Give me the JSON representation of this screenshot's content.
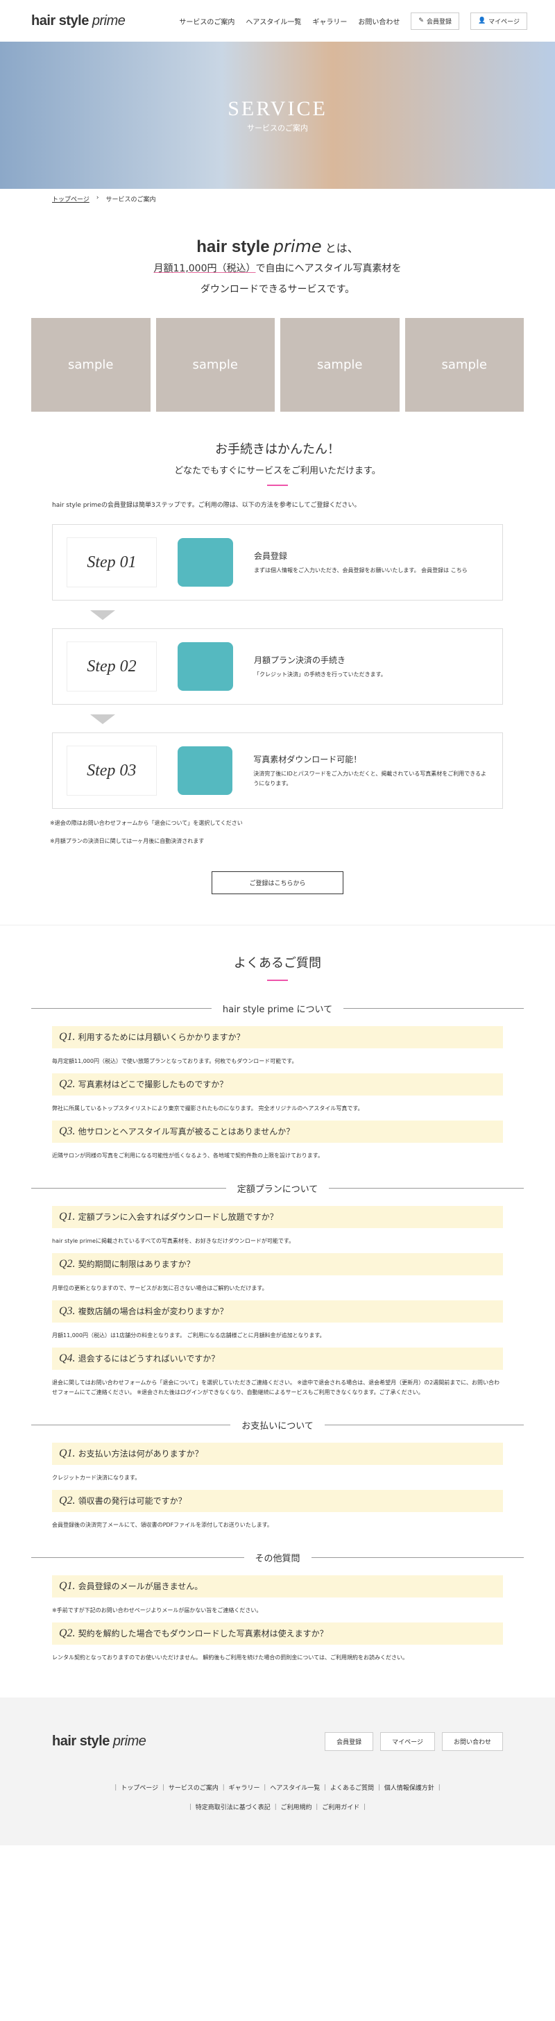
{
  "header": {
    "logo_bold": "hair style",
    "logo_italic": "prime",
    "nav": [
      "サービスのご案内",
      "ヘアスタイル一覧",
      "ギャラリー",
      "お問い合わせ"
    ],
    "member_btn": "会員登録",
    "mypage_btn": "マイページ"
  },
  "hero": {
    "title": "SERVICE",
    "subtitle": "サービスのご案内"
  },
  "breadcrumb": {
    "home": "トップページ",
    "current": "サービスのご案内"
  },
  "intro": {
    "logo_bold": "hair style",
    "logo_italic": "prime",
    "suffix": "とは、",
    "line1_price": "月額11,000円（税込）",
    "line1_rest": "で自由にヘアスタイル写真素材を",
    "line2": "ダウンロードできるサービスです。"
  },
  "gallery": [
    "sample",
    "sample",
    "sample",
    "sample"
  ],
  "steps_section": {
    "title": "お手続きはかんたん！",
    "subtitle": "どなたでもすぐにサービスをご利用いただけます。",
    "note": "hair style primeの会員登録は簡単3ステップです。ご利用の際は、以下の方法を参考にしてご登録ください。"
  },
  "steps": [
    {
      "label": "Step 01",
      "title": "会員登録",
      "text": "まずは個人情報をご入力いただき、会員登録をお願いいたします。 会員登録は こちら",
      "icon": "user-gear-icon"
    },
    {
      "label": "Step 02",
      "title": "月額プラン決済の手続き",
      "text": "「クレジット決済」の手続きを行っていただきます。",
      "icon": "laptop-icon"
    },
    {
      "label": "Step 03",
      "title": "写真素材ダウンロード可能！",
      "text": "決済完了後にIDとパスワードをご入力いただくと、掲載されている写真素材をご利用できるようになります。",
      "icon": "download-icon"
    }
  ],
  "step_notes": [
    "※退会の際はお問い合わせフォームから「退会について」を選択してください",
    "※月額プランの決済日に関しては一ヶ月後に自動決済されます"
  ],
  "register_btn": "ご登録はこちらから",
  "faq": {
    "title": "よくあるご質問",
    "categories": [
      {
        "name": "hair style prime について",
        "items": [
          {
            "num": "Q1.",
            "q": "利用するためには月額いくらかかりますか？",
            "a": "毎月定額11,000円（税込）で使い放題プランとなっております。何枚でもダウンロード可能です。"
          },
          {
            "num": "Q2.",
            "q": "写真素材はどこで撮影したものですか？",
            "a": "弊社に所属しているトップスタイリストにより東京で撮影されたものになります。 完全オリジナルのヘアスタイル写真です。"
          },
          {
            "num": "Q3.",
            "q": "他サロンとヘアスタイル写真が被ることはありませんか？",
            "a": "近隣サロンが同様の写真をご利用になる可能性が低くなるよう、各地域で契約件数の上限を設けております。"
          }
        ]
      },
      {
        "name": "定額プランについて",
        "items": [
          {
            "num": "Q1.",
            "q": "定額プランに入会すればダウンロードし放題ですか？",
            "a": "hair style primeに掲載されているすべての写真素材を、お好きなだけダウンロードが可能です。"
          },
          {
            "num": "Q2.",
            "q": "契約期間に制限はありますか？",
            "a": "月単位の更新となりますので、サービスがお気に召さない場合はご解約いただけます。"
          },
          {
            "num": "Q3.",
            "q": "複数店舗の場合は料金が変わりますか？",
            "a": "月額11,000円（税込）は1店舗分の料金となります。 ご利用になる店舗様ごとに月額料金が追加となります。"
          },
          {
            "num": "Q4.",
            "q": "退会するにはどうすればいいですか？",
            "a": "退会に関してはお問い合わせフォームから「退会について」を選択していただきご連絡ください。 ※途中で退会される場合は、退会希望月（更新月）の2週間前までに、お問い合わせフォームにてご連絡ください。 ※退会された後はログインができなくなり、自動継続によるサービスもご利用できなくなります。ご了承ください。"
          }
        ]
      },
      {
        "name": "お支払いについて",
        "items": [
          {
            "num": "Q1.",
            "q": "お支払い方法は何がありますか？",
            "a": "クレジットカード決済になります。"
          },
          {
            "num": "Q2.",
            "q": "領収書の発行は可能ですか？",
            "a": "会員登録後の決済完了メールにて、領収書のPDFファイルを添付してお送りいたします。"
          }
        ]
      },
      {
        "name": "その他質問",
        "items": [
          {
            "num": "Q1.",
            "q": "会員登録のメールが届きません。",
            "a": "※手前ですが下記のお問い合わせページよりメールが届かない旨をご連絡ください。"
          },
          {
            "num": "Q2.",
            "q": "契約を解約した場合でもダウンロードした写真素材は使えますか？",
            "a": "レンタル契約となっておりますのでお使いいただけません。 解約後もご利用を続けた場合の罰則金については、ご利用規約をお読みください。"
          }
        ]
      }
    ]
  },
  "footer": {
    "logo_bold": "hair style",
    "logo_italic": "prime",
    "member_btn": "会員登録",
    "mypage_btn": "マイページ",
    "contact_btn": "お問い合わせ",
    "links": "｜ トップページ ｜ サービスのご案内 ｜ ギャラリー ｜ ヘアスタイル一覧 ｜ よくあるご質問 ｜ 個人情報保護方針 ｜",
    "links2": "｜ 特定商取引法に基づく表記 ｜ ご利用規約 ｜ ご利用ガイド ｜"
  }
}
